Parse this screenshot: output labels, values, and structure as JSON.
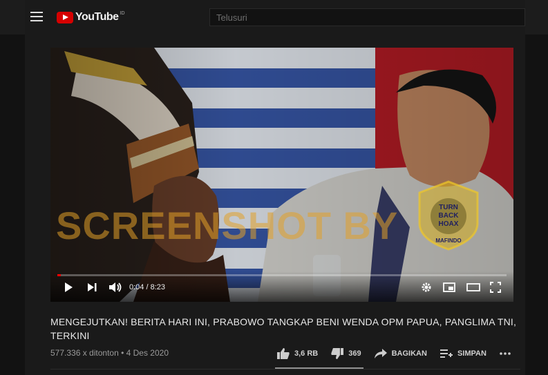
{
  "header": {
    "logo_text": "YouTube",
    "logo_region": "ID",
    "search_placeholder": "Telusuri"
  },
  "player": {
    "watermark": "SCREENSHOT BY",
    "badge_text": [
      "TURN",
      "BACK",
      "HOAX",
      "MAFINDO"
    ],
    "time": "0:04 / 8:23",
    "progress": 0.008
  },
  "video": {
    "title": "MENGEJUTKAN! BERITA HARI INI, PRABOWO TANGKAP BENI WENDA OPM PAPUA, PANGLIMA TNI, TERKINI",
    "views": "577.336 x ditonton • 4 Des 2020"
  },
  "actions": {
    "like_count": "3,6 RB",
    "dislike_count": "369",
    "share_label": "BAGIKAN",
    "save_label": "SIMPAN"
  }
}
